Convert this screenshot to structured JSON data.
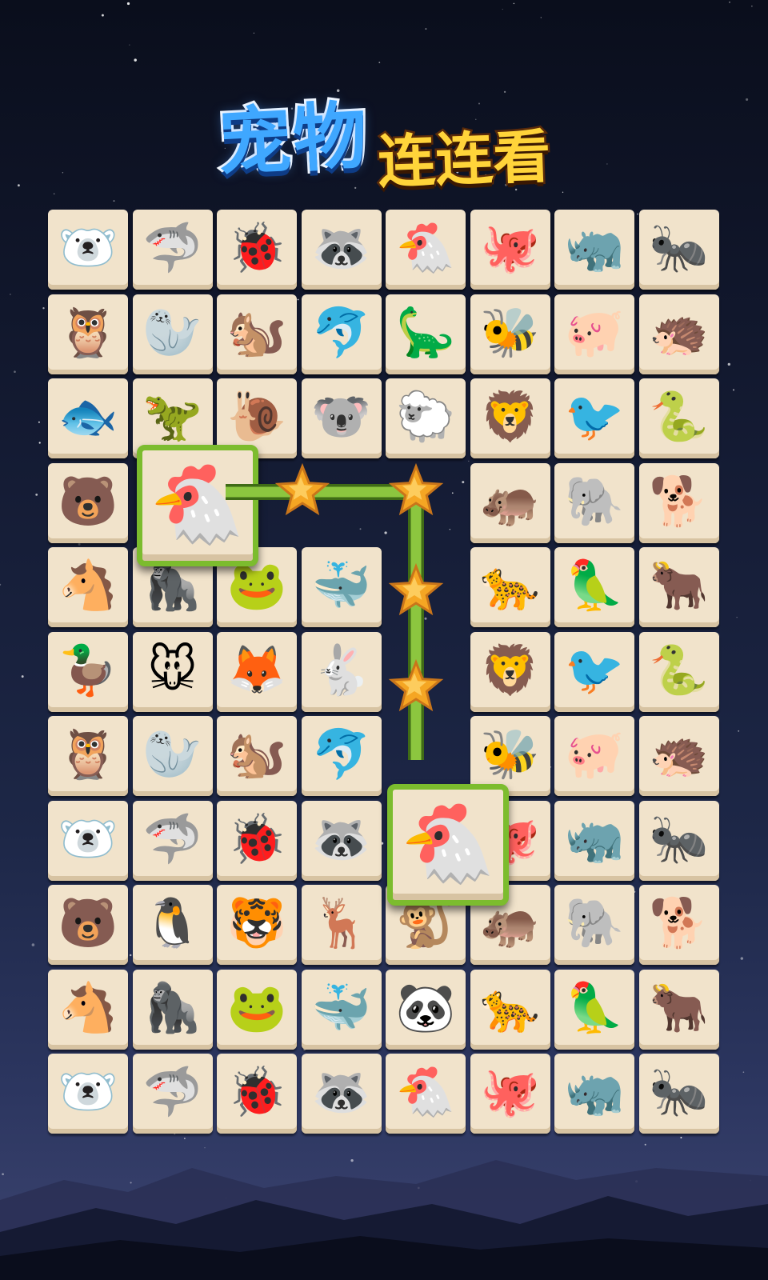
{
  "title": {
    "part1": "宠物",
    "part2": "连连看"
  },
  "board": {
    "rows": 11,
    "cols": 8,
    "tiles": [
      [
        {
          "animal": "polar-bear",
          "glyph": "🐻‍❄️"
        },
        {
          "animal": "shark",
          "glyph": "🦈"
        },
        {
          "animal": "ladybug",
          "glyph": "🐞"
        },
        {
          "animal": "raccoon",
          "glyph": "🦝"
        },
        {
          "animal": "chicken",
          "glyph": "🐔"
        },
        {
          "animal": "octopus",
          "glyph": "🐙"
        },
        {
          "animal": "rhino",
          "glyph": "🦏"
        },
        {
          "animal": "ant",
          "glyph": "🐜"
        }
      ],
      [
        {
          "animal": "owl",
          "glyph": "🦉"
        },
        {
          "animal": "seal",
          "glyph": "🦭"
        },
        {
          "animal": "squirrel",
          "glyph": "🐿️"
        },
        {
          "animal": "dolphin",
          "glyph": "🐬"
        },
        {
          "animal": "triceratops",
          "glyph": "🦕"
        },
        {
          "animal": "bee",
          "glyph": "🐝"
        },
        {
          "animal": "pig",
          "glyph": "🐖"
        },
        {
          "animal": "hedgehog",
          "glyph": "🦔"
        }
      ],
      [
        {
          "animal": "fish",
          "glyph": "🐟"
        },
        {
          "animal": "dinosaur",
          "glyph": "🦖"
        },
        {
          "animal": "snail",
          "glyph": "🐌"
        },
        {
          "animal": "koala",
          "glyph": "🐨"
        },
        {
          "animal": "sheep",
          "glyph": "🐑"
        },
        {
          "animal": "lion",
          "glyph": "🦁"
        },
        {
          "animal": "toucan",
          "glyph": "🐦"
        },
        {
          "animal": "snake",
          "glyph": "🐍"
        }
      ],
      [
        {
          "animal": "bear",
          "glyph": "🐻"
        },
        {
          "animal": "chicken",
          "glyph": "🐔"
        },
        {
          "animal": "empty",
          "glyph": ""
        },
        {
          "animal": "empty",
          "glyph": ""
        },
        {
          "animal": "empty",
          "glyph": ""
        },
        {
          "animal": "hippo",
          "glyph": "🦛"
        },
        {
          "animal": "elephant",
          "glyph": "🐘"
        },
        {
          "animal": "dog",
          "glyph": "🐕"
        }
      ],
      [
        {
          "animal": "horse",
          "glyph": "🐴"
        },
        {
          "animal": "gorilla",
          "glyph": "🦍"
        },
        {
          "animal": "frog",
          "glyph": "🐸"
        },
        {
          "animal": "whale",
          "glyph": "🐳"
        },
        {
          "animal": "empty",
          "glyph": ""
        },
        {
          "animal": "leopard",
          "glyph": "🐆"
        },
        {
          "animal": "parrot",
          "glyph": "🦜"
        },
        {
          "animal": "ox",
          "glyph": "🐂"
        }
      ],
      [
        {
          "animal": "duck",
          "glyph": "🦆"
        },
        {
          "animal": "mouse",
          "glyph": "🐭"
        },
        {
          "animal": "fox",
          "glyph": "🦊"
        },
        {
          "animal": "rabbit",
          "glyph": "🐇"
        },
        {
          "animal": "empty",
          "glyph": ""
        },
        {
          "animal": "lion",
          "glyph": "🦁"
        },
        {
          "animal": "toucan",
          "glyph": "🐦"
        },
        {
          "animal": "snake",
          "glyph": "🐍"
        }
      ],
      [
        {
          "animal": "owl",
          "glyph": "🦉"
        },
        {
          "animal": "seal",
          "glyph": "🦭"
        },
        {
          "animal": "squirrel",
          "glyph": "🐿️"
        },
        {
          "animal": "dolphin",
          "glyph": "🐬"
        },
        {
          "animal": "empty",
          "glyph": ""
        },
        {
          "animal": "bee",
          "glyph": "🐝"
        },
        {
          "animal": "pig",
          "glyph": "🐖"
        },
        {
          "animal": "hedgehog",
          "glyph": "🦔"
        }
      ],
      [
        {
          "animal": "polar-bear",
          "glyph": "🐻‍❄️"
        },
        {
          "animal": "shark",
          "glyph": "🦈"
        },
        {
          "animal": "ladybug",
          "glyph": "🐞"
        },
        {
          "animal": "raccoon",
          "glyph": "🦝"
        },
        {
          "animal": "chicken",
          "glyph": "🐔"
        },
        {
          "animal": "octopus",
          "glyph": "🐙"
        },
        {
          "animal": "rhino",
          "glyph": "🦏"
        },
        {
          "animal": "ant",
          "glyph": "🐜"
        }
      ],
      [
        {
          "animal": "bear",
          "glyph": "🐻"
        },
        {
          "animal": "penguin",
          "glyph": "🐧"
        },
        {
          "animal": "tiger",
          "glyph": "🐯"
        },
        {
          "animal": "deer",
          "glyph": "🦌"
        },
        {
          "animal": "monkey",
          "glyph": "🐒"
        },
        {
          "animal": "hippo",
          "glyph": "🦛"
        },
        {
          "animal": "elephant",
          "glyph": "🐘"
        },
        {
          "animal": "dog",
          "glyph": "🐕"
        }
      ],
      [
        {
          "animal": "horse",
          "glyph": "🐴"
        },
        {
          "animal": "gorilla",
          "glyph": "🦍"
        },
        {
          "animal": "frog",
          "glyph": "🐸"
        },
        {
          "animal": "whale",
          "glyph": "🐳"
        },
        {
          "animal": "panda",
          "glyph": "🐼"
        },
        {
          "animal": "leopard",
          "glyph": "🐆"
        },
        {
          "animal": "parrot",
          "glyph": "🦜"
        },
        {
          "animal": "ox",
          "glyph": "🐂"
        }
      ],
      [
        {
          "animal": "polar-bear",
          "glyph": "🐻‍❄️"
        },
        {
          "animal": "shark",
          "glyph": "🦈"
        },
        {
          "animal": "ladybug",
          "glyph": "🐞"
        },
        {
          "animal": "raccoon",
          "glyph": "🦝"
        },
        {
          "animal": "chicken",
          "glyph": "🐔"
        },
        {
          "animal": "octopus",
          "glyph": "🐙"
        },
        {
          "animal": "rhino",
          "glyph": "🦏"
        },
        {
          "animal": "ant",
          "glyph": "🐜"
        }
      ]
    ],
    "selected": [
      {
        "row": 3,
        "col": 1,
        "animal": "chicken",
        "glyph": "🐔"
      },
      {
        "row": 7,
        "col": 4,
        "animal": "chicken",
        "glyph": "🐔"
      }
    ],
    "match_path_stars": 4,
    "colors": {
      "tile_face": "#f1e3cb",
      "selection_border": "#7cbc2e",
      "path_line": "#8cc63f",
      "star": "#f5a623"
    }
  }
}
